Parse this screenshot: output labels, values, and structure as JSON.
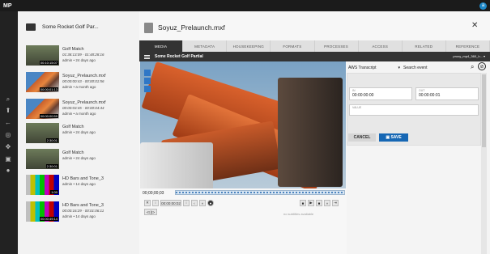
{
  "app": {
    "logo": "MP",
    "avatar": "a"
  },
  "rail_icons": [
    "search-icon",
    "upload-icon",
    "back-icon",
    "tag-icon",
    "pin-icon",
    "gear-icon",
    "palette-icon"
  ],
  "collection": {
    "title": "Some Rocket Golf Par..."
  },
  "assets": [
    {
      "title": "Golf Match",
      "tc": "01:38:13:09 - 01:48:28:16",
      "meta": "admin • 24 days ago",
      "dur": "00:10:15:07",
      "thumb": "gray"
    },
    {
      "title": "Soyuz_Prelaunch.mxf",
      "tc": "00:00:00:43 - 00:00:01:56",
      "meta": "admin • a month ago",
      "dur": "00:00:01:13",
      "thumb": "rocket"
    },
    {
      "title": "Soyuz_Prelaunch.mxf",
      "tc": "00:00:03:45 - 00:00:04:44",
      "meta": "admin • a month ago",
      "dur": "00:00:00:59",
      "thumb": "rocket"
    },
    {
      "title": "Golf Match",
      "tc": "",
      "meta": "admin • 24 days ago",
      "dur": "2:30:01",
      "thumb": "gray"
    },
    {
      "title": "Golf Match",
      "tc": "",
      "meta": "admin • 24 days ago",
      "dur": "2:30:01",
      "thumb": "gray"
    },
    {
      "title": "HD Bars and Tone_3",
      "tc": "",
      "meta": "admin • 14 days ago",
      "dur": "1:00",
      "thumb": "bars"
    },
    {
      "title": "HD Bars and Tone_3",
      "tc": "00:00:16:29 - 00:01:06:11",
      "meta": "admin • 14 days ago",
      "dur": "00:00:49:14",
      "thumb": "bars"
    }
  ],
  "detail": {
    "title": "Soyuz_Prelaunch.mxf",
    "tabs": [
      "MEDIA",
      "METADATA",
      "HOUSEKEEPING",
      "FORMATS",
      "PROCESSES",
      "ACCESS",
      "RELATED",
      "REFERENCE"
    ],
    "active_tab": "MEDIA",
    "subbar_title": "Some Rocket Golf Partial",
    "format_select": "proxy_mp4_360_h..."
  },
  "player": {
    "timecode": "00;00;00;03",
    "frame_value": "00:00:00:02",
    "subtitles_text": "no subtitles available",
    "label": "<t [t>"
  },
  "side": {
    "transcript_select": "AWS Transcript",
    "search_event": "Search event",
    "in_label": "IN",
    "in_value": "00:00:00:00",
    "out_label": "OUT",
    "out_value": "00:00:00:01",
    "value_label": "VALUE",
    "cancel": "CANCEL",
    "save": "SAVE"
  },
  "colors": {
    "accent": "#1667b4",
    "dark": "#333333"
  }
}
